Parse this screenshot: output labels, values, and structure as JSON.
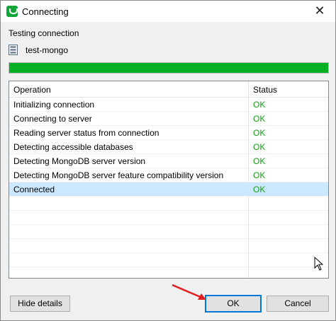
{
  "window": {
    "title": "Connecting",
    "close_symbol": "✕"
  },
  "header": {
    "status_label": "Testing connection",
    "connection_name": "test-mongo"
  },
  "progress": {
    "value_percent": 100,
    "fill_color": "#06b025"
  },
  "table": {
    "columns": [
      "Operation",
      "Status"
    ],
    "rows": [
      {
        "operation": "Initializing connection",
        "status": "OK"
      },
      {
        "operation": "Connecting to server",
        "status": "OK"
      },
      {
        "operation": "Reading server status from connection",
        "status": "OK"
      },
      {
        "operation": "Detecting accessible databases",
        "status": "OK"
      },
      {
        "operation": "Detecting MongoDB server version",
        "status": "OK"
      },
      {
        "operation": "Detecting MongoDB server feature compatibility version",
        "status": "OK"
      },
      {
        "operation": "Connected",
        "status": "OK",
        "selected": true
      }
    ],
    "status_color": "#12a012",
    "selected_row_color": "#cce8ff"
  },
  "footer": {
    "hide_details_label": "Hide details",
    "ok_label": "OK",
    "cancel_label": "Cancel"
  },
  "icons": {
    "app": "app-logo-icon",
    "database": "database-icon",
    "close": "close-icon",
    "cursor": "mouse-cursor-icon",
    "annotation": "red-arrow-annotation"
  }
}
